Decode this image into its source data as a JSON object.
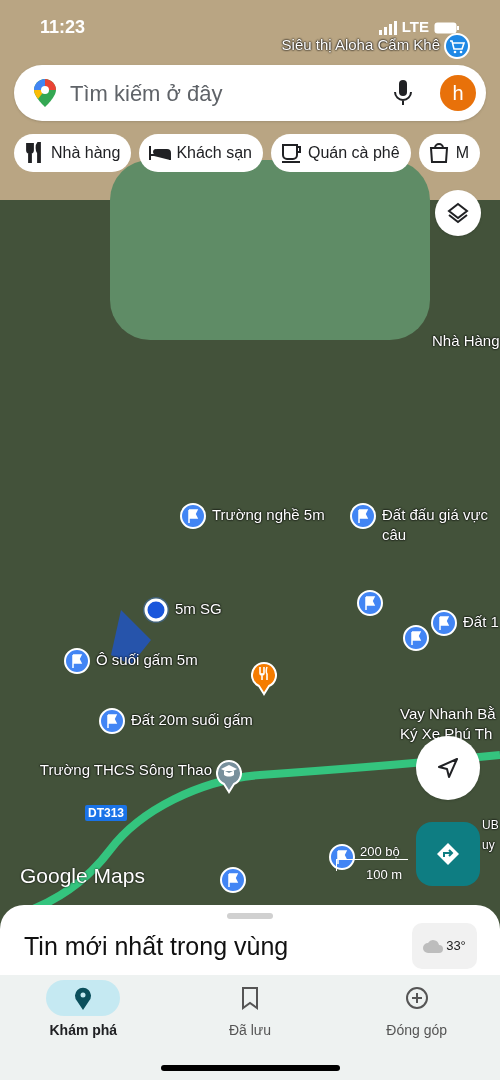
{
  "status_bar": {
    "time": "11:23",
    "network": "LTE"
  },
  "search": {
    "placeholder": "Tìm kiếm ở đây",
    "avatar": "h"
  },
  "chips": [
    {
      "kind": "restaurant",
      "label": "Nhà hàng"
    },
    {
      "kind": "hotel",
      "label": "Khách sạn"
    },
    {
      "kind": "cafe",
      "label": "Quán cà phê"
    },
    {
      "kind": "shopping",
      "label": "M"
    }
  ],
  "map": {
    "places": [
      {
        "kind": "cart",
        "lines": [
          "Siêu thị Aloha Cẩm Khê"
        ]
      },
      {
        "kind": "text",
        "lines": [
          "Nhà Hàng"
        ]
      },
      {
        "kind": "flag",
        "lines": [
          "Trường nghề 5m"
        ]
      },
      {
        "kind": "flag",
        "lines": [
          "Đất đấu giá vực",
          "câu"
        ]
      },
      {
        "kind": "location",
        "lines": [
          "5m SG"
        ]
      },
      {
        "kind": "flag",
        "lines": [
          "Ô suối gấm 5m"
        ]
      },
      {
        "kind": "flag"
      },
      {
        "kind": "flag",
        "lines": [
          "Đất 1"
        ]
      },
      {
        "kind": "flag"
      },
      {
        "kind": "restaurant"
      },
      {
        "kind": "flag",
        "lines": [
          "Đất 20m suối gấm"
        ]
      },
      {
        "kind": "text",
        "lines": [
          "Vay Nhanh Bằ",
          "Ký Xe Phú Th"
        ]
      },
      {
        "kind": "school",
        "lines": [
          "Trường THCS Sông Thao"
        ]
      },
      {
        "kind": "flag"
      },
      {
        "kind": "flag"
      },
      {
        "kind": "text",
        "lines": [
          "UB",
          "uy"
        ]
      }
    ],
    "road_badge": "DT313",
    "logo": "Google Maps",
    "scale": {
      "upper": "200 bộ",
      "lower": "100 m"
    }
  },
  "sheet": {
    "title": "Tin mới nhất trong vùng",
    "weather": "33°"
  },
  "nav": [
    {
      "kind": "explore",
      "label": "Khám phá",
      "selected": true
    },
    {
      "kind": "saved",
      "label": "Đã lưu",
      "selected": false
    },
    {
      "kind": "contribute",
      "label": "Đóng góp",
      "selected": false
    }
  ]
}
